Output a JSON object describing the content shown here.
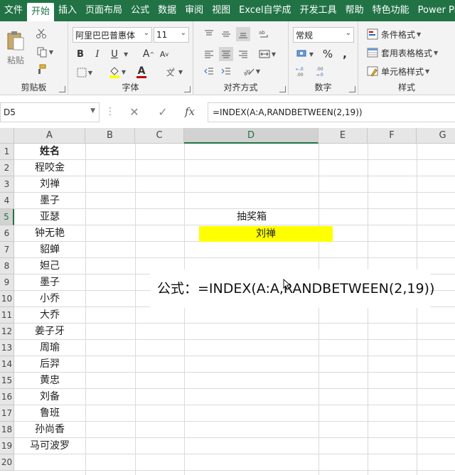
{
  "tabs": [
    "文件",
    "开始",
    "插入",
    "页面布局",
    "公式",
    "数据",
    "审阅",
    "视图",
    "Excel自学成",
    "开发工具",
    "帮助",
    "特色功能",
    "Power Pivo"
  ],
  "active_tab": "开始",
  "ribbon": {
    "clipboard": {
      "label": "剪贴板",
      "paste": "粘贴"
    },
    "font": {
      "label": "字体",
      "font_name": "阿里巴巴普惠体",
      "font_size": "11",
      "bold": "B",
      "italic": "I",
      "underline": "U",
      "grow": "A",
      "shrink": "A",
      "font_color_glyph": "A"
    },
    "alignment": {
      "label": "对齐方式"
    },
    "number": {
      "label": "数字",
      "format": "常规",
      "percent": "%",
      "comma": ","
    },
    "styles": {
      "label": "样式",
      "conditional": "条件格式",
      "table": "套用表格格式",
      "cell_styles": "单元格样式"
    }
  },
  "formula_bar": {
    "name_box": "D5",
    "formula": "=INDEX(A:A,RANDBETWEEN(2,19))",
    "fx": "fx"
  },
  "columns": [
    "A",
    "B",
    "C",
    "D",
    "E",
    "F",
    "G"
  ],
  "active_column": "D",
  "rows": [
    "1",
    "2",
    "3",
    "4",
    "5",
    "6",
    "7",
    "8",
    "9",
    "10",
    "11",
    "12",
    "13",
    "14",
    "15",
    "16",
    "17",
    "18",
    "19",
    "20"
  ],
  "active_row": "5",
  "column_a": [
    "姓名",
    "程咬金",
    "刘禅",
    "墨子",
    "亚瑟",
    "钟无艳",
    "貂蝉",
    "妲己",
    "墨子",
    "小乔",
    "大乔",
    "姜子牙",
    "周瑜",
    "后羿",
    "黄忠",
    "刘备",
    "鲁班",
    "孙尚香",
    "马可波罗"
  ],
  "d4": "抽奖箱",
  "d5": "刘禅",
  "callout": "公式：=INDEX(A:A,RANDBETWEEN(2,19))",
  "colors": {
    "ribbon_green": "#217346",
    "highlight": "#ffff00"
  }
}
